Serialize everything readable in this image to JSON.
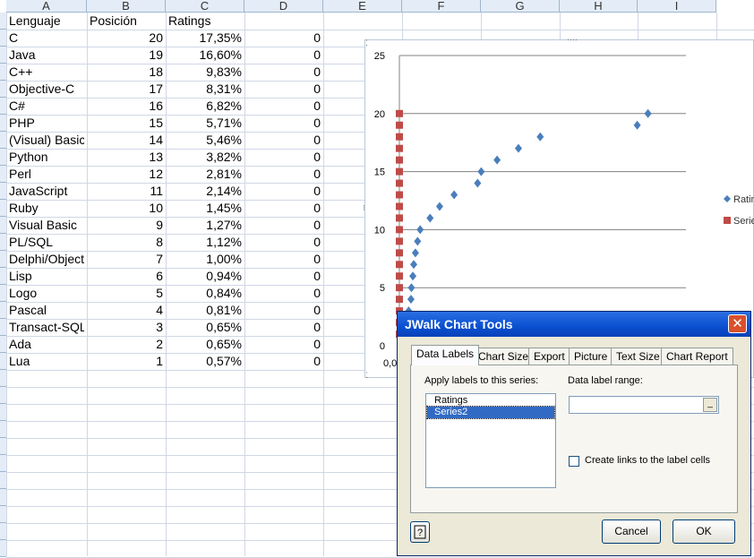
{
  "spreadsheet": {
    "columns": [
      "A",
      "B",
      "C",
      "D",
      "E",
      "F",
      "G",
      "H",
      "I"
    ],
    "rows": [
      [
        "Lenguaje",
        "Posición",
        "Ratings",
        ""
      ],
      [
        "C",
        "20",
        "17,35%",
        "0"
      ],
      [
        "Java",
        "19",
        "16,60%",
        "0"
      ],
      [
        "C++",
        "18",
        "9,83%",
        "0"
      ],
      [
        "Objective-C",
        "17",
        "8,31%",
        "0"
      ],
      [
        "C#",
        "16",
        "6,82%",
        "0"
      ],
      [
        "PHP",
        "15",
        "5,71%",
        "0"
      ],
      [
        "(Visual) Basic",
        "14",
        "5,46%",
        "0"
      ],
      [
        "Python",
        "13",
        "3,82%",
        "0"
      ],
      [
        "Perl",
        "12",
        "2,81%",
        "0"
      ],
      [
        "JavaScript",
        "11",
        "2,14%",
        "0"
      ],
      [
        "Ruby",
        "10",
        "1,45%",
        "0"
      ],
      [
        "Visual Basic",
        "9",
        "1,27%",
        "0"
      ],
      [
        "PL/SQL",
        "8",
        "1,12%",
        "0"
      ],
      [
        "Delphi/Object",
        "7",
        "1,00%",
        "0"
      ],
      [
        "Lisp",
        "6",
        "0,94%",
        "0"
      ],
      [
        "Logo",
        "5",
        "0,84%",
        "0"
      ],
      [
        "Pascal",
        "4",
        "0,81%",
        "0"
      ],
      [
        "Transact-SQL",
        "3",
        "0,65%",
        "0"
      ],
      [
        "Ada",
        "2",
        "0,65%",
        "0"
      ],
      [
        "Lua",
        "1",
        "0,57%",
        "0"
      ]
    ]
  },
  "chart_data": {
    "type": "scatter",
    "yticks": [
      "25",
      "20",
      "15",
      "10",
      "5",
      "0"
    ],
    "ylim": [
      0,
      25
    ],
    "xlabel_visible": "0,0",
    "series": [
      {
        "name": "Ratings",
        "color": "#4a7ebb",
        "marker": "diamond",
        "points": [
          [
            17.35,
            20
          ],
          [
            16.6,
            19
          ],
          [
            9.83,
            18
          ],
          [
            8.31,
            17
          ],
          [
            6.82,
            16
          ],
          [
            5.71,
            15
          ],
          [
            5.46,
            14
          ],
          [
            3.82,
            13
          ],
          [
            2.81,
            12
          ],
          [
            2.14,
            11
          ],
          [
            1.45,
            10
          ],
          [
            1.27,
            9
          ],
          [
            1.12,
            8
          ],
          [
            1.0,
            7
          ],
          [
            0.94,
            6
          ],
          [
            0.84,
            5
          ],
          [
            0.81,
            4
          ],
          [
            0.65,
            3
          ],
          [
            0.65,
            2
          ],
          [
            0.57,
            1
          ]
        ]
      },
      {
        "name": "Series2",
        "color": "#be4b48",
        "marker": "square",
        "points": [
          [
            0,
            20
          ],
          [
            0,
            19
          ],
          [
            0,
            18
          ],
          [
            0,
            17
          ],
          [
            0,
            16
          ],
          [
            0,
            15
          ],
          [
            0,
            14
          ],
          [
            0,
            13
          ],
          [
            0,
            12
          ],
          [
            0,
            11
          ],
          [
            0,
            10
          ],
          [
            0,
            9
          ],
          [
            0,
            8
          ],
          [
            0,
            7
          ],
          [
            0,
            6
          ],
          [
            0,
            5
          ],
          [
            0,
            4
          ],
          [
            0,
            3
          ],
          [
            0,
            2
          ],
          [
            0,
            1
          ]
        ]
      }
    ],
    "legend": [
      "Ratin",
      "Serie"
    ],
    "legend_position": "right"
  },
  "dialog": {
    "title": "JWalk Chart Tools",
    "close": "✕",
    "tabs": [
      "Data Labels",
      "Chart Size",
      "Export",
      "Picture",
      "Text Size",
      "Chart Report"
    ],
    "apply_label": "Apply labels to this series:",
    "series_items": [
      "Ratings",
      "Series2"
    ],
    "range_label": "Data label range:",
    "range_value": "",
    "range_btn": "_",
    "link_label": "Create links to the label cells",
    "help": "?",
    "cancel": "Cancel",
    "ok": "OK"
  }
}
